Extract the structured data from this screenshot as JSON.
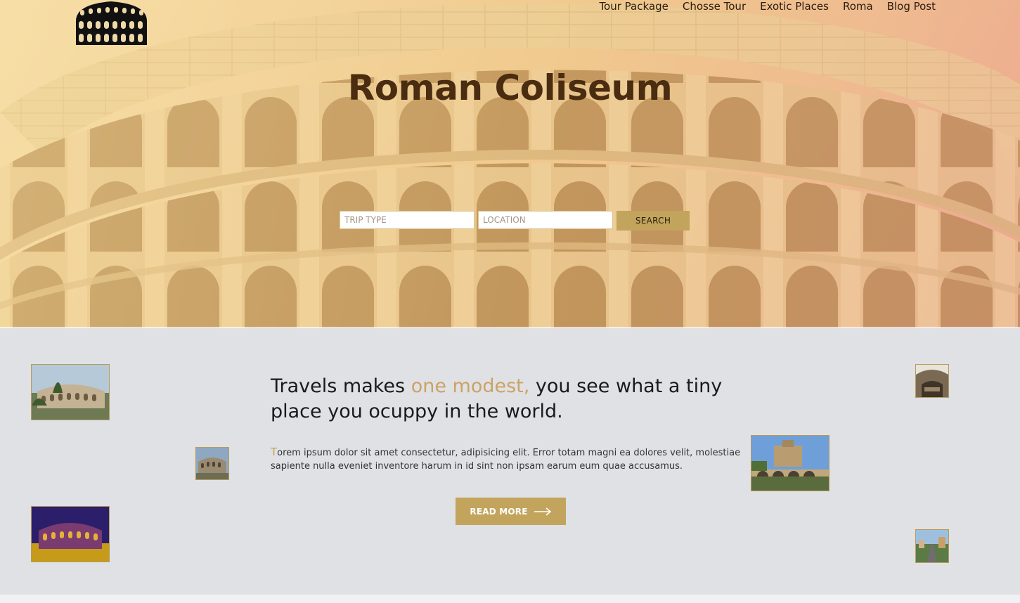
{
  "nav": {
    "items": [
      "Tour Package",
      "Chosse Tour",
      "Exotic Places",
      "Roma",
      "Blog Post"
    ]
  },
  "hero": {
    "title": "Roman Coliseum"
  },
  "search": {
    "trip_type_placeholder": "TRIP TYPE",
    "location_placeholder": "LOCATION",
    "button_label": "SEARCH"
  },
  "content": {
    "tagline_part1": "Travels makes ",
    "tagline_accent": "one modest,",
    "tagline_part2": " you see what a tiny place you ocuppy in the world.",
    "paragraph_first_letter": "T",
    "paragraph_rest": "orem ipsum dolor sit amet consectetur, adipisicing elit. Error totam magni ea dolores velit, molestiae sapiente nulla eveniet inventore harum in id sint non ipsam earum eum quae accusamus.",
    "read_more_label": "READ MORE"
  },
  "colors": {
    "accent": "#c2a45d",
    "accent_text": "#cba366",
    "title_brown": "#4a2d10",
    "content_bg": "#dfe1e5"
  },
  "icons": {
    "logo": "colosseum-logo-icon",
    "read_more_arrow": "arrow-right-icon"
  }
}
